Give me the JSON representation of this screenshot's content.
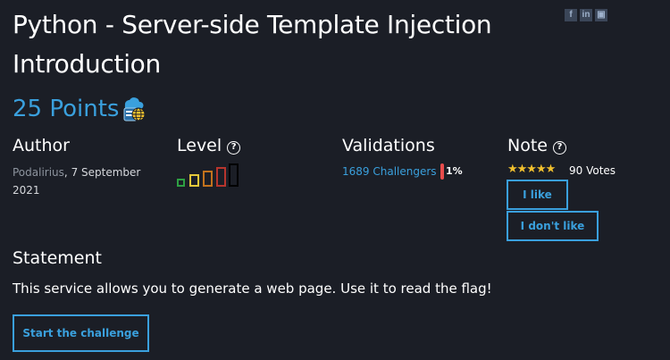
{
  "page": {
    "title": "Python - Server-side Template Injection Introduction",
    "points": "25 Points",
    "category_icon": "web-server-globe-icon"
  },
  "share": {
    "items": [
      {
        "icon": "facebook-icon",
        "glyph": "f"
      },
      {
        "icon": "linkedin-icon",
        "glyph": "in"
      },
      {
        "icon": "share-icon",
        "glyph": "▣"
      }
    ]
  },
  "author": {
    "heading": "Author",
    "name": "Podalirius",
    "separator": ",",
    "date": "7 September 2021"
  },
  "level": {
    "heading": "Level",
    "help_icon": "question-circle-icon",
    "help_glyph": "?",
    "current": 4,
    "max": 5,
    "colors": [
      "#2ea043",
      "#e3c73a",
      "#c2721d",
      "#b7352d",
      "#000000"
    ]
  },
  "validations": {
    "heading": "Validations",
    "challengers": "1689 Challengers",
    "percent": "1%"
  },
  "note": {
    "heading": "Note",
    "help_icon": "question-circle-icon",
    "help_glyph": "?",
    "stars": "★★★★★",
    "votes": "90 Votes",
    "like_label": "I like",
    "dislike_label": "I don't like"
  },
  "statement": {
    "heading": "Statement",
    "text": "This service allows you to generate a web page. Use it to read the flag!",
    "start_label": "Start the challenge"
  },
  "colors": {
    "background": "#1b1e26",
    "accent": "#3aa0dd",
    "star": "#f2c12e",
    "percent_bar": "#e84c4c"
  }
}
